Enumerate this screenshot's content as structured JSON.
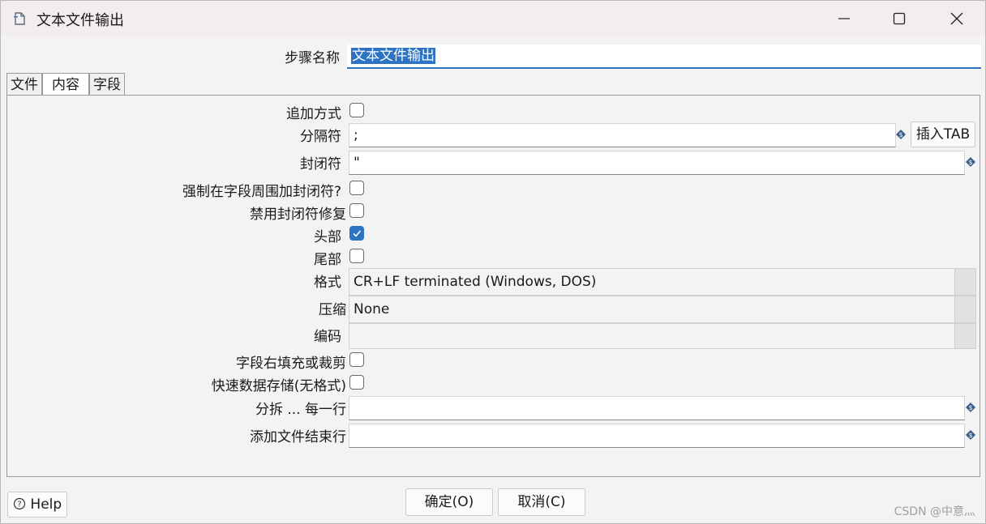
{
  "window": {
    "title": "文本文件输出"
  },
  "step_name": {
    "label": "步骤名称",
    "value": "文本文件输出"
  },
  "tabs": [
    {
      "label": "文件"
    },
    {
      "label": "内容"
    },
    {
      "label": "字段"
    }
  ],
  "active_tab": "内容",
  "form": {
    "append_label": "追加方式",
    "separator_label": "分隔符",
    "separator_value": ";",
    "insert_tab_label": "插入TAB",
    "enclosure_label": "封闭符",
    "enclosure_value": "\"",
    "force_enclosure_label": "强制在字段周围加封闭符?",
    "disable_enclosure_fix_label": "禁用封闭符修复",
    "header_label": "头部",
    "header_checked": true,
    "footer_label": "尾部",
    "format_label": "格式",
    "format_value": "CR+LF terminated (Windows, DOS)",
    "compression_label": "压缩",
    "compression_value": "None",
    "encoding_label": "编码",
    "encoding_value": "",
    "pad_label": "字段右填充或裁剪",
    "fast_dump_label": "快速数据存储(无格式)",
    "split_label": "分拆 ... 每一行",
    "split_value": "",
    "end_line_label": "添加文件结束行",
    "end_line_value": ""
  },
  "buttons": {
    "help": "Help",
    "ok": "确定(O)",
    "cancel": "取消(C)"
  },
  "watermark": "CSDN @中意灬",
  "colors": {
    "accent": "#2c73c4",
    "titlebar": "#f3eeee"
  }
}
